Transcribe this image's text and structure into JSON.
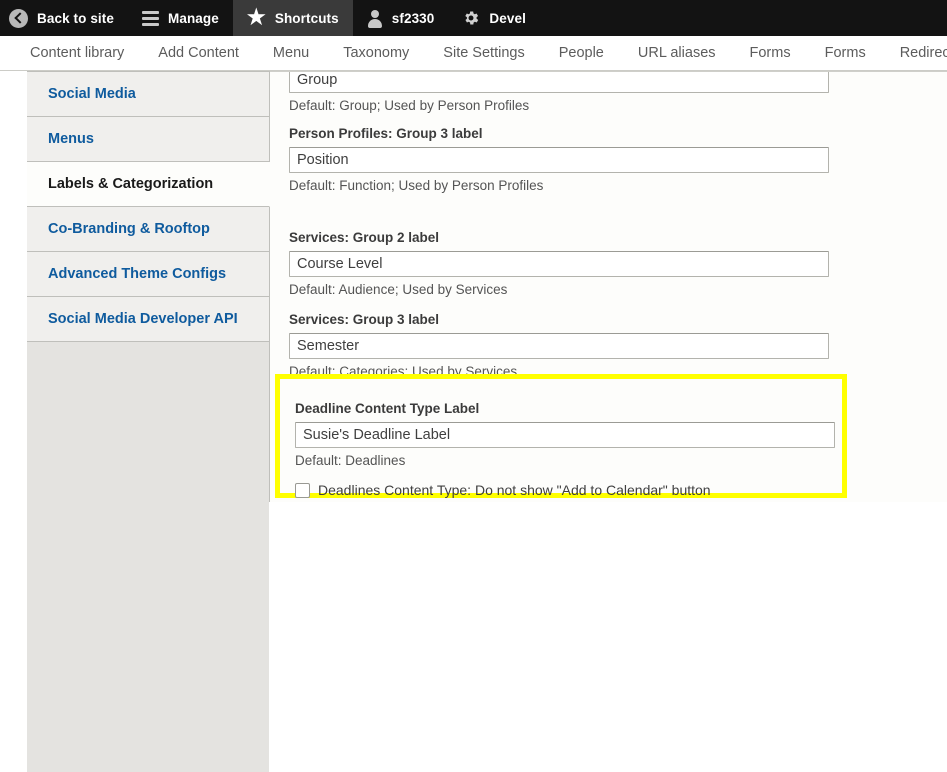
{
  "toolbar": {
    "items": [
      {
        "label": "Back to site",
        "icon": "back-arrow-icon",
        "active": false
      },
      {
        "label": "Manage",
        "icon": "hamburger-icon",
        "active": false
      },
      {
        "label": "Shortcuts",
        "icon": "star-icon",
        "active": true
      },
      {
        "label": "sf2330",
        "icon": "person-icon",
        "active": false
      },
      {
        "label": "Devel",
        "icon": "gear-icon",
        "active": false
      }
    ]
  },
  "subnav": {
    "items": [
      "Content library",
      "Add Content",
      "Menu",
      "Taxonomy",
      "Site Settings",
      "People",
      "URL aliases",
      "Forms",
      "Forms",
      "Redirects"
    ]
  },
  "sidebar": {
    "items": [
      {
        "label": "Social Media",
        "selected": false
      },
      {
        "label": "Menus",
        "selected": false
      },
      {
        "label": "Labels & Categorization",
        "selected": true
      },
      {
        "label": "Co-Branding & Rooftop",
        "selected": false
      },
      {
        "label": "Advanced Theme Configs",
        "selected": false
      },
      {
        "label": "Social Media Developer API",
        "selected": false
      }
    ]
  },
  "form": {
    "fields": [
      {
        "label": "",
        "value": "Group",
        "description": "Default: Group; Used by Person Profiles"
      },
      {
        "label": "Person Profiles: Group 3 label",
        "value": "Position",
        "description": "Default: Function; Used by Person Profiles"
      },
      {
        "label": "Services: Group 2 label",
        "value": "Course Level",
        "description": "Default: Audience; Used by Services"
      },
      {
        "label": "Services: Group 3 label",
        "value": "Semester",
        "description": "Default: Categories; Used by Services"
      }
    ],
    "highlighted": {
      "label": "Deadline Content Type Label",
      "value": "Susie's Deadline Label",
      "description": "Default: Deadlines",
      "checkbox_label": "Deadlines Content Type: Do not show \"Add to Calendar\" button",
      "checkbox_checked": false,
      "highlight_color": "#ffff00"
    }
  },
  "colors": {
    "toolbar_bg": "#131313",
    "toolbar_active_bg": "#3a3a3a",
    "link_blue": "#0f5b9e",
    "sidebar_bg": "#e4e3e0",
    "tab_bg": "#f0efed",
    "content_bg": "#fdfdfb",
    "highlight": "#ffff00"
  }
}
